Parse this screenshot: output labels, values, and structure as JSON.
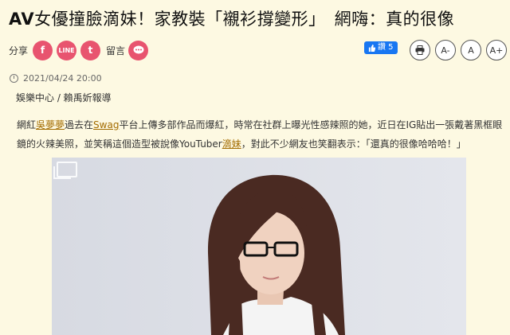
{
  "article": {
    "title_prefix": "AV",
    "title_rest": "女優撞臉滴妹！家教裝「襯衫撐變形」　網嗨：真的很像",
    "date": "2021/04/24 20:00",
    "byline": "娛樂中心 / 賴禹妡報導",
    "p1_a": "網紅",
    "p1_link1": "吳夢夢",
    "p1_b": "過去在",
    "p1_link2": "Swag",
    "p1_c": "平台上傳多部作品而爆紅，時常在社群上曝光性感辣照的她，近日在IG貼出一張戴著黑框眼鏡的火辣美照，並笑稱這個造型被說像YouTuber",
    "p1_link3": "滴妹",
    "p1_d": "，對此不少網友也笑翻表示：「還真的很像哈哈哈！」"
  },
  "share": {
    "label": "分享",
    "facebook": "f",
    "line": "LINE",
    "twitter": "t",
    "comment_label": "留言",
    "like_label": "讚 5"
  },
  "tools": {
    "print_icon": "print-icon",
    "font_smaller": "A-",
    "font_normal": "A",
    "font_larger": "A+"
  },
  "colors": {
    "background": "#fdf9e2",
    "share_pink": "#e8546f",
    "link": "#a36c00",
    "facebook_blue": "#1877f2"
  }
}
